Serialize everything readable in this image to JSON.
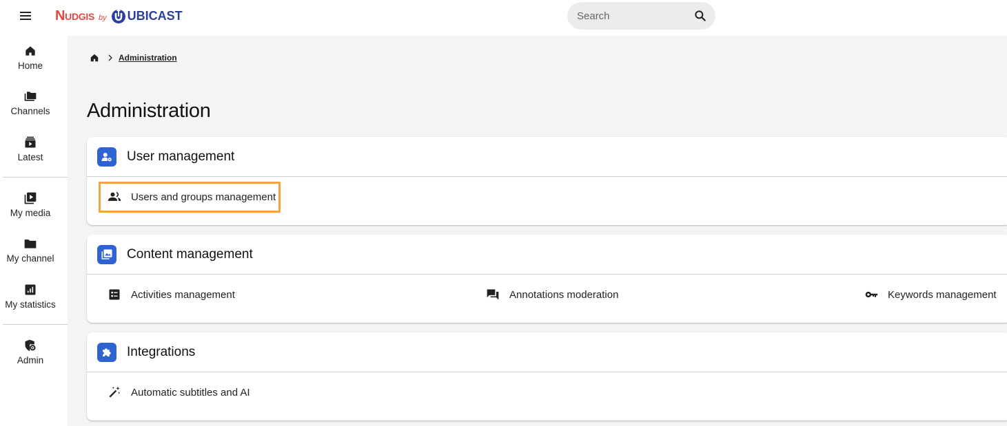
{
  "header": {
    "menu_icon": "menu-icon",
    "logo": {
      "brand": "Nudgis",
      "by": "by",
      "company": "UBICAST"
    },
    "search": {
      "placeholder": "Search",
      "value": "",
      "icon": "search-icon"
    }
  },
  "sidebar": {
    "items": [
      {
        "label": "Home",
        "icon": "home-icon"
      },
      {
        "label": "Channels",
        "icon": "folders-icon"
      },
      {
        "label": "Latest",
        "icon": "latest-video-icon"
      },
      {
        "label": "My media",
        "icon": "video-library-icon"
      },
      {
        "label": "My channel",
        "icon": "folder-icon"
      },
      {
        "label": "My statistics",
        "icon": "statistics-icon"
      },
      {
        "label": "Admin",
        "icon": "admin-shield-icon"
      }
    ]
  },
  "breadcrumb": {
    "home_icon": "home-icon",
    "current": "Administration"
  },
  "page": {
    "title": "Administration"
  },
  "sections": [
    {
      "title": "User management",
      "icon": "user-settings-icon",
      "links": [
        {
          "label": "Users and groups management",
          "icon": "group-icon",
          "highlighted": true
        }
      ]
    },
    {
      "title": "Content management",
      "icon": "media-library-icon",
      "links": [
        {
          "label": "Activities management",
          "icon": "checklist-icon"
        },
        {
          "label": "Annotations moderation",
          "icon": "forum-icon"
        },
        {
          "label": "Keywords management",
          "icon": "key-icon"
        }
      ]
    },
    {
      "title": "Integrations",
      "icon": "puzzle-icon",
      "links": [
        {
          "label": "Automatic subtitles and AI",
          "icon": "magic-wand-icon"
        }
      ]
    }
  ],
  "colors": {
    "accent": "#2f63d3",
    "highlight": "#f5a340",
    "brand_red": "#e8473f",
    "brand_blue": "#2a3f9c",
    "background": "#f4f4f4"
  }
}
